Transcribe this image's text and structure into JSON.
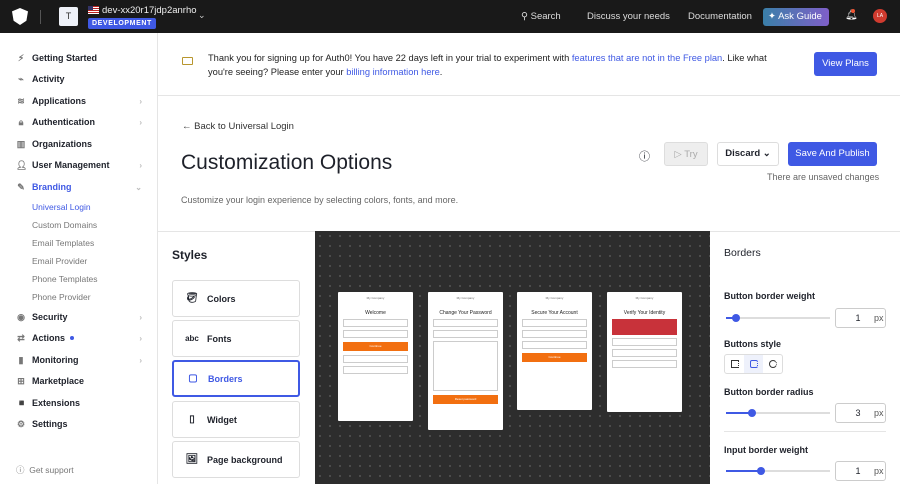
{
  "topbar": {
    "tenant_initial": "T",
    "tenant": "dev-xx20r17jdp2anrho",
    "env": "DEVELOPMENT",
    "search": "Search",
    "discuss": "Discuss your needs",
    "docs": "Documentation",
    "ask": "Ask Guide",
    "avatar": "LA"
  },
  "sidebar": {
    "items": [
      "Getting Started",
      "Activity",
      "Applications",
      "Authentication",
      "Organizations",
      "User Management",
      "Branding",
      "Security",
      "Actions",
      "Monitoring",
      "Marketplace",
      "Extensions",
      "Settings"
    ],
    "branding_sub": [
      "Universal Login",
      "Custom Domains",
      "Email Templates",
      "Email Provider",
      "Phone Templates",
      "Phone Provider"
    ],
    "support": "Get support"
  },
  "banner": {
    "text1": "Thank you for signing up for Auth0! You have 22 days left in your trial to experiment with ",
    "link1": "features that are not in the Free plan",
    "text2": ". Like what you're seeing? Please enter your ",
    "link2": "billing information here",
    "text3": ".",
    "button": "View Plans"
  },
  "page": {
    "back": "Back to Universal Login",
    "title": "Customization Options",
    "description": "Customize your login experience by selecting colors, fonts, and more.",
    "try": "Try",
    "discard": "Discard",
    "save": "Save And Publish",
    "unsaved": "There are unsaved changes"
  },
  "styles": {
    "title": "Styles",
    "items": [
      "Colors",
      "Fonts",
      "Borders",
      "Widget",
      "Page background"
    ]
  },
  "preview": {
    "company": "My Company",
    "titles": [
      "Welcome",
      "Change Your Password",
      "Secure Your Account",
      "Verify Your Identity"
    ],
    "continue": "Continue",
    "reset": "Reset password"
  },
  "borders": {
    "title": "Borders",
    "button_weight_label": "Button border weight",
    "button_weight": 1,
    "buttons_style_label": "Buttons style",
    "button_radius_label": "Button border radius",
    "button_radius": 3,
    "input_weight_label": "Input border weight",
    "input_weight": 1,
    "unit": "px"
  }
}
